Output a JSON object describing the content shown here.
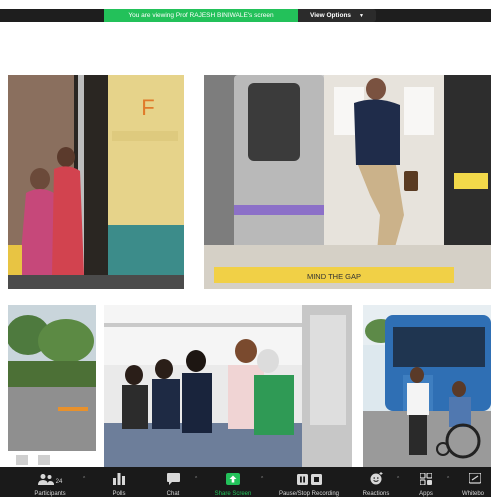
{
  "banner": {
    "viewing_text": "You are viewing Prof RAJESH BINIWALE's screen",
    "view_options_label": "View Options"
  },
  "slide": {
    "photos": [
      {
        "name": "photo-boarding-train"
      },
      {
        "name": "photo-metro-door"
      },
      {
        "name": "photo-station-road"
      },
      {
        "name": "photo-seated-passengers"
      },
      {
        "name": "photo-wheelchair-bus"
      }
    ],
    "train_car_letter": "F",
    "platform_text": "MIND THE GAP"
  },
  "toolbar": {
    "participants_label": "Participants",
    "participants_count": "24",
    "polls_label": "Polls",
    "chat_label": "Chat",
    "share_screen_label": "Share Screen",
    "pause_recording_label": "Pause/Stop Recording",
    "reactions_label": "Reactions",
    "apps_label": "Apps",
    "whiteboard_label": "Whitebo",
    "accent_color": "#23c15a"
  }
}
